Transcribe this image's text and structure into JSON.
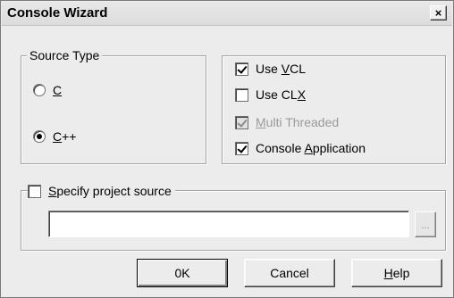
{
  "window": {
    "title": "Console Wizard",
    "close_glyph": "×",
    "close_icon": "close-icon"
  },
  "source_type": {
    "legend": "Source Type",
    "options": [
      {
        "prefix": "",
        "mnemonic": "C",
        "suffix": "",
        "selected": false
      },
      {
        "prefix": "",
        "mnemonic": "C",
        "suffix": "++",
        "selected": true
      }
    ]
  },
  "options": {
    "items": [
      {
        "prefix": "Use ",
        "mnemonic": "V",
        "suffix": "CL",
        "checked": true,
        "enabled": true
      },
      {
        "prefix": "Use CL",
        "mnemonic": "X",
        "suffix": "",
        "checked": false,
        "enabled": true
      },
      {
        "prefix": "",
        "mnemonic": "M",
        "suffix": "ulti Threaded",
        "checked": true,
        "enabled": false
      },
      {
        "prefix": "Console ",
        "mnemonic": "A",
        "suffix": "pplication",
        "checked": true,
        "enabled": true
      }
    ]
  },
  "project_source": {
    "checkbox_mnemonic": "S",
    "checkbox_suffix": "pecify project source",
    "checked": false,
    "path_value": "",
    "browse_label": "..."
  },
  "buttons": {
    "ok": "0K",
    "cancel": "Cancel",
    "help_mnemonic": "H",
    "help_suffix": "elp"
  }
}
